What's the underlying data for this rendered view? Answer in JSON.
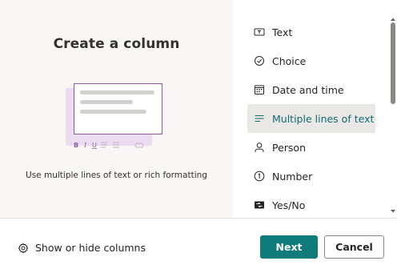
{
  "left_pane": {
    "title": "Create a column",
    "description": "Use multiple lines of text or rich formatting",
    "illustration_icon": "multiline-text-illustration"
  },
  "column_types": [
    {
      "label": "Text",
      "icon": "text-box-icon",
      "selected": false
    },
    {
      "label": "Choice",
      "icon": "choice-check-icon",
      "selected": false
    },
    {
      "label": "Date and time",
      "icon": "calendar-icon",
      "selected": false
    },
    {
      "label": "Multiple lines of text",
      "icon": "multiline-text-icon",
      "selected": true
    },
    {
      "label": "Person",
      "icon": "person-icon",
      "selected": false
    },
    {
      "label": "Number",
      "icon": "number-icon",
      "selected": false
    },
    {
      "label": "Yes/No",
      "icon": "yes-no-icon",
      "selected": false
    }
  ],
  "footer": {
    "show_hide_label": "Show or hide columns",
    "next_label": "Next",
    "cancel_label": "Cancel"
  },
  "colors": {
    "accent": "#0f7b7b",
    "selected_text": "#116b6b",
    "selected_bg": "#e9e8e7",
    "left_pane_bg": "#f8f7f6",
    "illustration_purple": "#8e5a9b"
  }
}
